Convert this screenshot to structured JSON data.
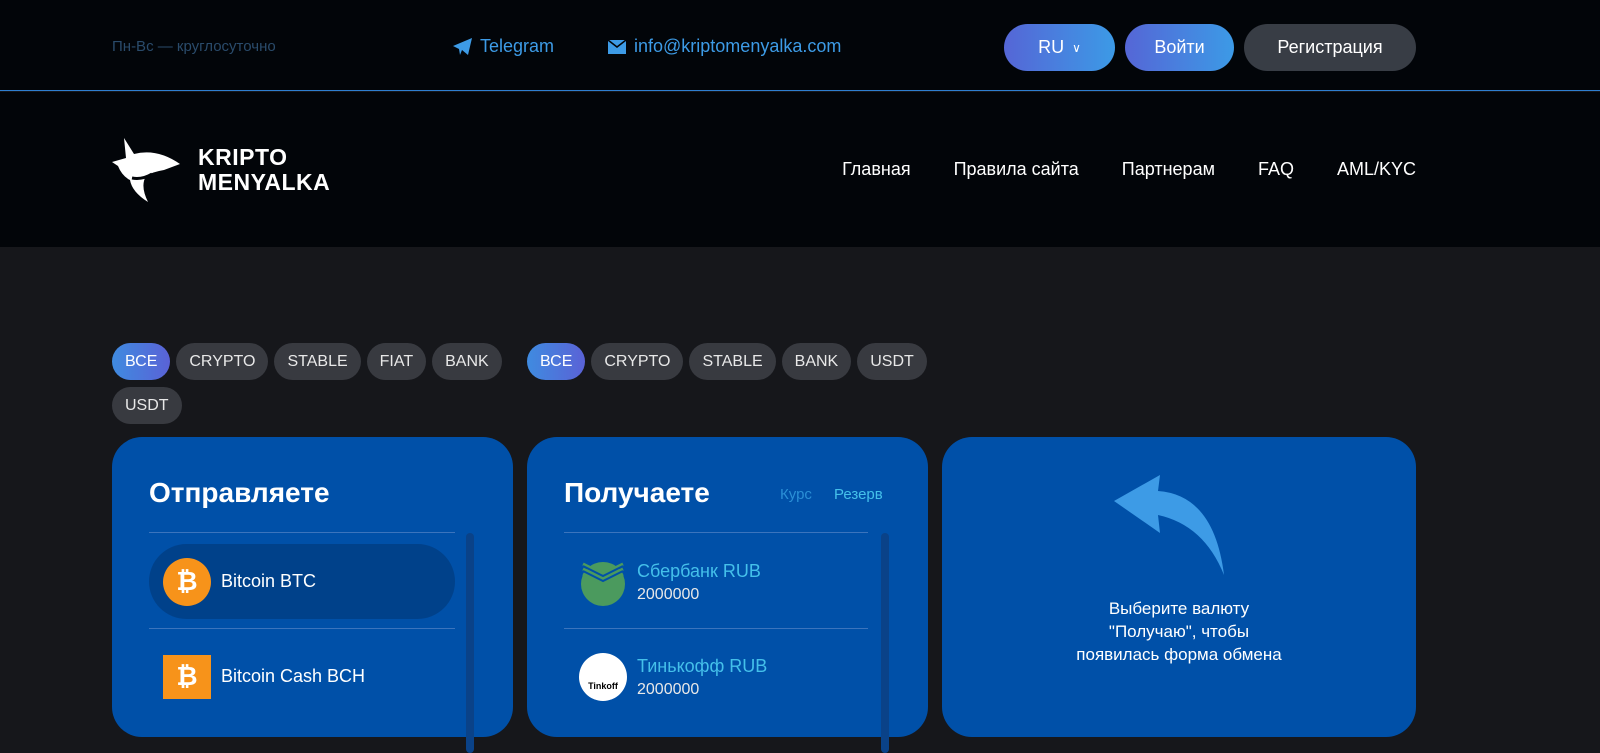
{
  "topbar": {
    "hours": "Пн-Вс — круглосуточно",
    "telegram": "Telegram",
    "email": "info@kriptomenyalka.com",
    "lang": "RU",
    "login": "Войти",
    "register": "Регистрация"
  },
  "logo": {
    "line1": "KRIPTO",
    "line2": "MENYALKA"
  },
  "nav": [
    "Главная",
    "Правила сайта",
    "Партнерам",
    "FAQ",
    "AML/KYC"
  ],
  "send_filters": [
    "ВСЕ",
    "CRYPTO",
    "STABLE",
    "FIAT",
    "BANK",
    "USDT"
  ],
  "receive_filters": [
    "ВСЕ",
    "CRYPTO",
    "STABLE",
    "BANK",
    "USDT"
  ],
  "send": {
    "title": "Отправляете",
    "items": [
      "Bitcoin BTC",
      "Bitcoin Cash BCH"
    ]
  },
  "receive": {
    "title": "Получаете",
    "rate": "Курс",
    "reserve": "Резерв",
    "items": [
      {
        "name": "Сбербанк RUB",
        "value": "2000000"
      },
      {
        "name": "Тинькофф RUB",
        "value": "2000000"
      }
    ]
  },
  "hint": {
    "line1": "Выберите валюту",
    "line2": "\"Получаю\", чтобы",
    "line3": "появилась форма обмена"
  }
}
